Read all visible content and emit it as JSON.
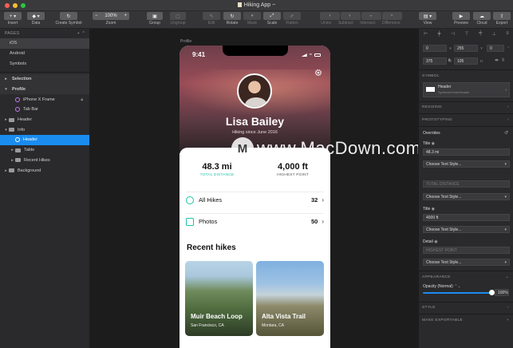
{
  "window": {
    "title": "Hiking App",
    "title_suffix": "~"
  },
  "toolbar": {
    "insert": "Insert",
    "data": "Data",
    "create_symbol": "Create Symbol",
    "zoom_label": "Zoom",
    "zoom_value": "100%",
    "zoom_minus": "−",
    "zoom_plus": "+",
    "group": "Group",
    "ungroup": "Ungroup",
    "edit": "Edit",
    "rotate": "Rotate",
    "mask": "Mask",
    "scale": "Scale",
    "flatten": "Flatten",
    "union": "Union",
    "subtract": "Subtract",
    "intersect": "Intersect",
    "difference": "Difference",
    "view": "View",
    "preview": "Preview",
    "cloud": "Cloud",
    "export": "Export"
  },
  "pages": {
    "header": "PAGES",
    "add": "+",
    "collapse": "^",
    "items": [
      {
        "label": "iOS",
        "selected": true
      },
      {
        "label": "Android",
        "selected": false
      },
      {
        "label": "Symbols",
        "selected": false
      }
    ]
  },
  "layers": [
    {
      "label": "Selection",
      "indent": 0,
      "tri": "▸",
      "kind": "page",
      "bold": true
    },
    {
      "label": "Profile",
      "indent": 0,
      "tri": "▾",
      "kind": "page",
      "bold": true
    },
    {
      "label": "iPhone X Frame",
      "indent": 1,
      "tri": "",
      "kind": "symbol",
      "locked": true
    },
    {
      "label": "Tab Bar",
      "indent": 1,
      "tri": "",
      "kind": "symbol"
    },
    {
      "label": "Header",
      "indent": 0,
      "tri": "▸",
      "kind": "folder"
    },
    {
      "label": "Info",
      "indent": 0,
      "tri": "▾",
      "kind": "folder"
    },
    {
      "label": "Header",
      "indent": 1,
      "tri": "",
      "kind": "symbol",
      "selected": true
    },
    {
      "label": "Table",
      "indent": 1,
      "tri": "▸",
      "kind": "folder"
    },
    {
      "label": "Recent Hikes",
      "indent": 1,
      "tri": "▸",
      "kind": "folder"
    },
    {
      "label": "Background",
      "indent": 0,
      "tri": "▸",
      "kind": "folder"
    }
  ],
  "canvas": {
    "artboard_label": "Profile"
  },
  "phone": {
    "time": "9:41",
    "name": "Lisa Bailey",
    "subtitle": "Hiking since June 2016",
    "stats": [
      {
        "value": "48.3 mi",
        "label": "TOTAL DISTANCE",
        "color": "#19c4a8"
      },
      {
        "value": "4,000 ft",
        "label": "HIGHEST POINT",
        "color": "#555555"
      }
    ],
    "rows": [
      {
        "label": "All Hikes",
        "count": "32",
        "chev": "›"
      },
      {
        "label": "Photos",
        "count": "50",
        "chev": "›"
      }
    ],
    "recent_title": "Recent hikes",
    "hikes": [
      {
        "title": "Muir Beach Loop",
        "location": "San Francisco, CA"
      },
      {
        "title": "Alta Vista Trail",
        "location": "Montara, CA"
      }
    ]
  },
  "watermark": {
    "text": "www.MacDown.com",
    "logo": "M"
  },
  "inspector": {
    "fields": {
      "x": "0",
      "y": "255",
      "r": "0",
      "w": "375",
      "h": "105",
      "xl": "X",
      "yl": "Y",
      "rl": "°",
      "wl": "W",
      "hl": "H"
    },
    "symbol_header": "SYMBOL",
    "symbol_name": "Header",
    "symbol_path": "Symbols/Cells/Header",
    "resizing": "RESIZING",
    "prototyping": "PROTOTYPING",
    "overrides": "Overrides",
    "title1_label": "Title",
    "title1_value": "48.3 mi",
    "choose_style": "Choose Text Style...",
    "subtitle1_ph": "TOTAL DISTANCE",
    "title2_label": "Title",
    "title2_value": "4000 ft",
    "detail_label": "Detail",
    "detail_ph": "HIGHEST POINT",
    "appearance": "APPEARANCE",
    "opacity_label": "Opacity (Normal)",
    "opacity_value": "100%",
    "opacity_level": 1.0,
    "style": "STYLE",
    "make_exportable": "MAKE EXPORTABLE"
  }
}
